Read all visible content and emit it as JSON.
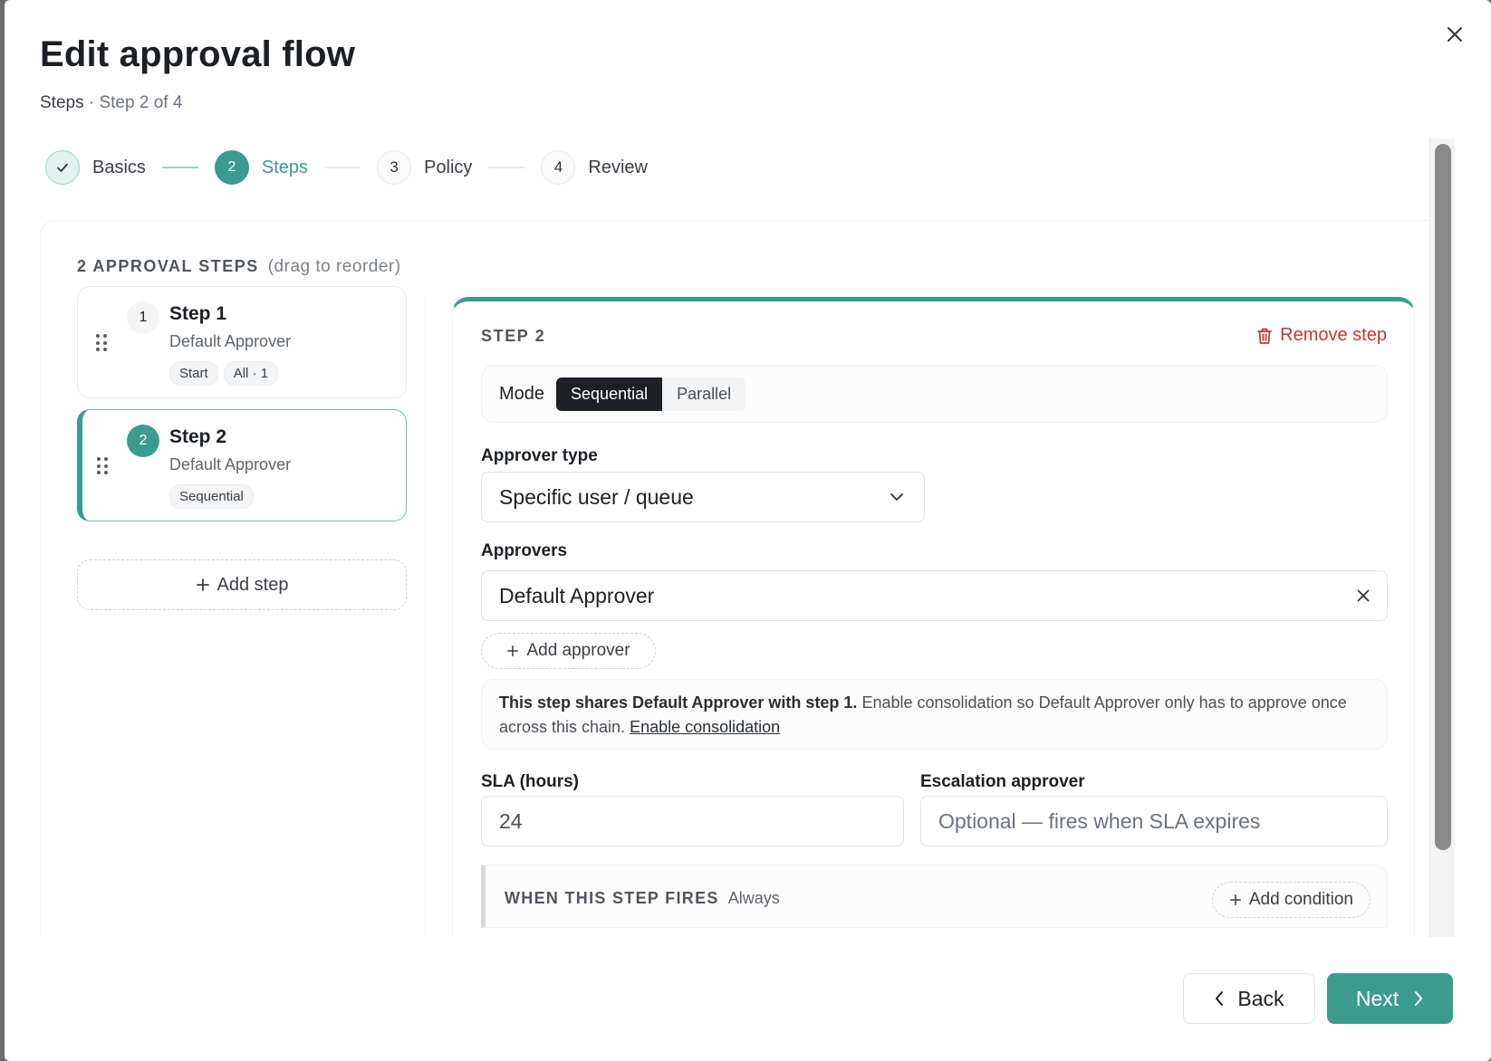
{
  "dialog": {
    "title": "Edit approval flow",
    "subtitle_section": "Steps",
    "subtitle_sep": " · ",
    "subtitle_progress": "Step 2 of 4"
  },
  "stepper": {
    "steps": [
      {
        "num": "",
        "label": "Basics",
        "state": "done"
      },
      {
        "num": "2",
        "label": "Steps",
        "state": "active"
      },
      {
        "num": "3",
        "label": "Policy",
        "state": "todo"
      },
      {
        "num": "4",
        "label": "Review",
        "state": "todo"
      }
    ]
  },
  "step_list": {
    "heading": "2 APPROVAL STEPS",
    "hint": "(drag to reorder)",
    "items": [
      {
        "num": "1",
        "title": "Step 1",
        "approver": "Default Approver",
        "chips": [
          "Start",
          "All · 1"
        ]
      },
      {
        "num": "2",
        "title": "Step 2",
        "approver": "Default Approver",
        "chips": [
          "Sequential"
        ]
      }
    ],
    "add_label": "Add step"
  },
  "editor": {
    "title": "STEP 2",
    "remove_label": "Remove step",
    "mode_label": "Mode",
    "mode_options": [
      "Sequential",
      "Parallel"
    ],
    "mode_selected": "Sequential",
    "approver_type_label": "Approver type",
    "approver_type_value": "Specific user / queue",
    "approvers_label": "Approvers",
    "approvers": [
      "Default Approver"
    ],
    "add_approver_label": "Add approver",
    "notice_bold": "This step shares Default Approver with step 1.",
    "notice_text": " Enable consolidation so Default Approver only has to approve once across this chain. ",
    "notice_link": "Enable consolidation",
    "sla_label": "SLA (hours)",
    "sla_value": "24",
    "escalation_label": "Escalation approver",
    "escalation_placeholder": "Optional — fires when SLA expires",
    "condition_title": "WHEN THIS STEP FIRES",
    "condition_value": "Always",
    "add_condition_label": "Add condition"
  },
  "footer": {
    "back_label": "Back",
    "next_label": "Next"
  },
  "colors": {
    "accent": "#3b9b8f",
    "danger": "#c03838",
    "dark": "#1c2024"
  }
}
